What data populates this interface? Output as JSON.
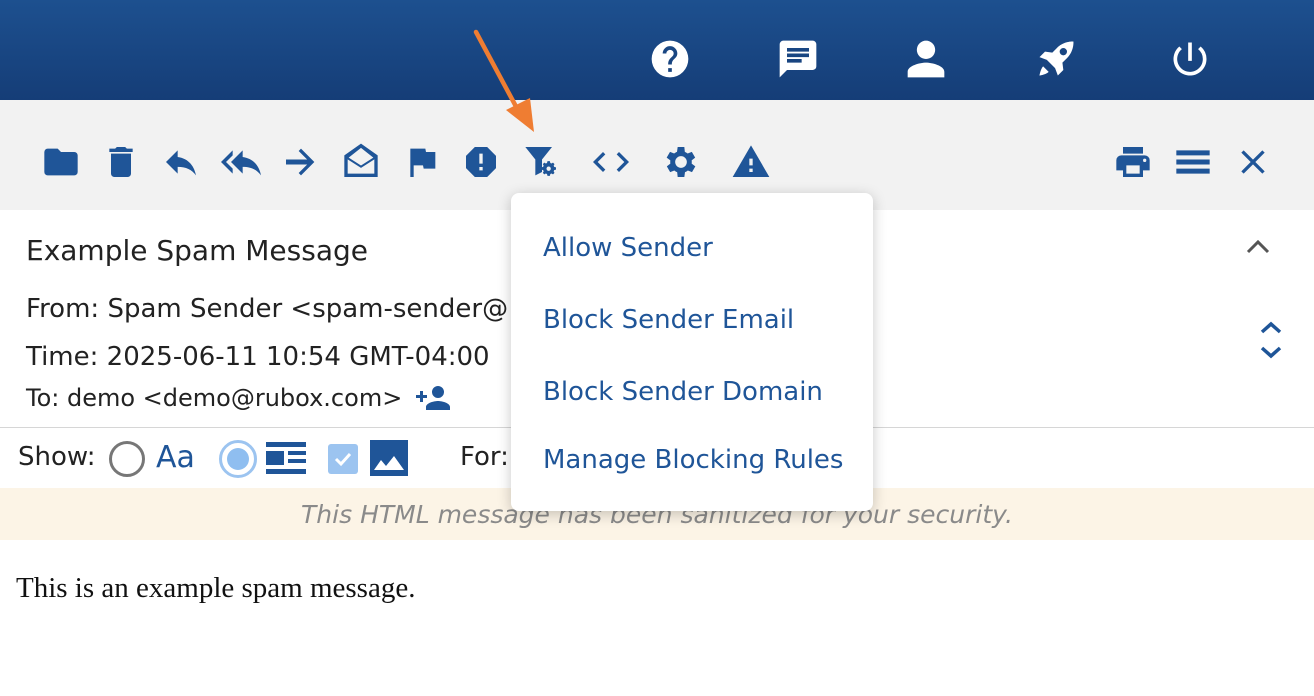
{
  "colors": {
    "header": "#1a4785",
    "accent": "#1f5598",
    "toolbar_bg": "#f2f2f2",
    "annotation": "#ef7d32",
    "notice_bg": "#fcf4e6"
  },
  "header_icons": [
    "help-icon",
    "chat-icon",
    "user-icon",
    "rocket-icon",
    "power-icon"
  ],
  "toolbar_icons": [
    "folder-icon",
    "trash-icon",
    "reply-icon",
    "reply-all-icon",
    "forward-icon",
    "mark-read-icon",
    "flag-icon",
    "spam-icon",
    "filter-settings-icon",
    "source-code-icon",
    "gear-icon",
    "warning-icon",
    "print-icon",
    "menu-icon",
    "close-icon"
  ],
  "message": {
    "subject": "Example Spam Message",
    "from": "From: Spam Sender <spam-sender@",
    "time": "Time: 2025-06-11 10:54 GMT-04:00",
    "to": "To: demo <demo@rubox.com>"
  },
  "show_bar": {
    "show_label": "Show:",
    "plain_label": "Aa",
    "for_label": "For:"
  },
  "notice": "This HTML message has been sanitized for your security.",
  "body": "This is an example spam message.",
  "dropdown": {
    "items": [
      "Allow Sender",
      "Block Sender Email",
      "Block Sender Domain",
      "Manage Blocking Rules"
    ]
  }
}
